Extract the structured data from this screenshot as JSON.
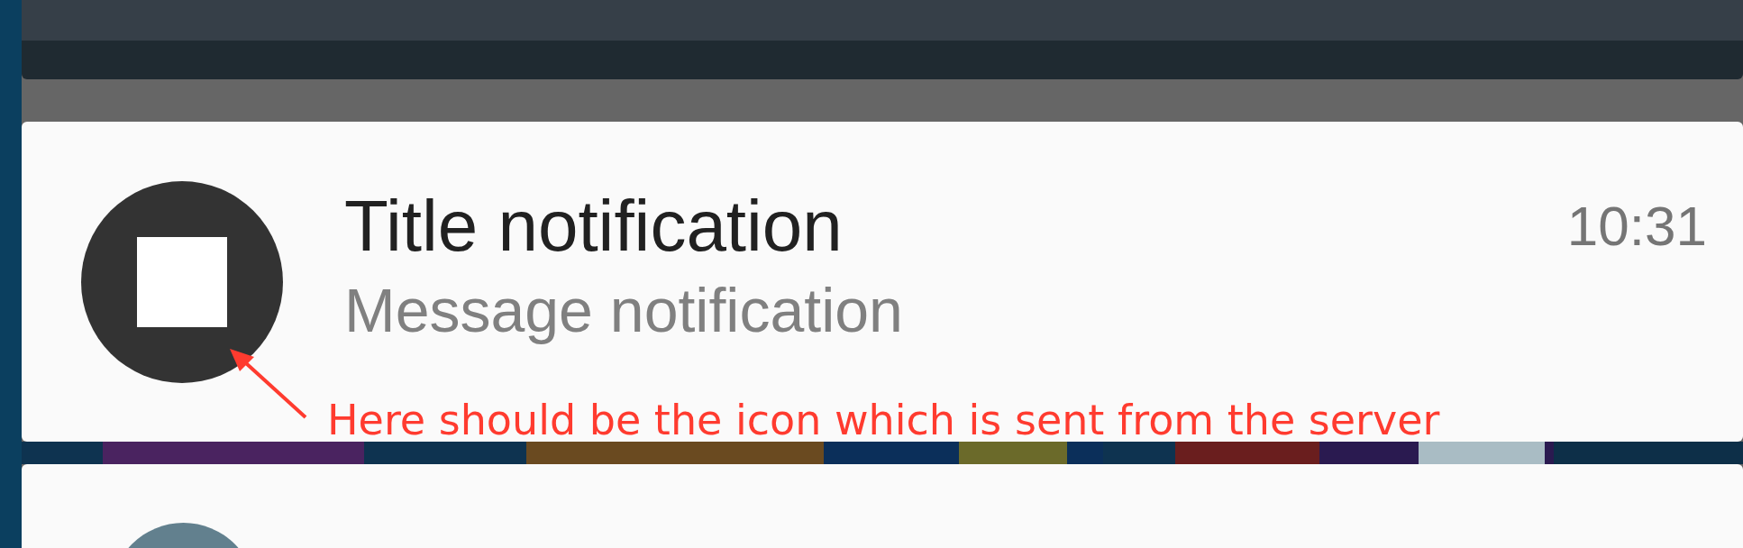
{
  "notification": {
    "title": "Title notification",
    "message": "Message notification",
    "time": "10:31"
  },
  "annotation": {
    "text": "Here should be the icon which is sent from the server"
  }
}
